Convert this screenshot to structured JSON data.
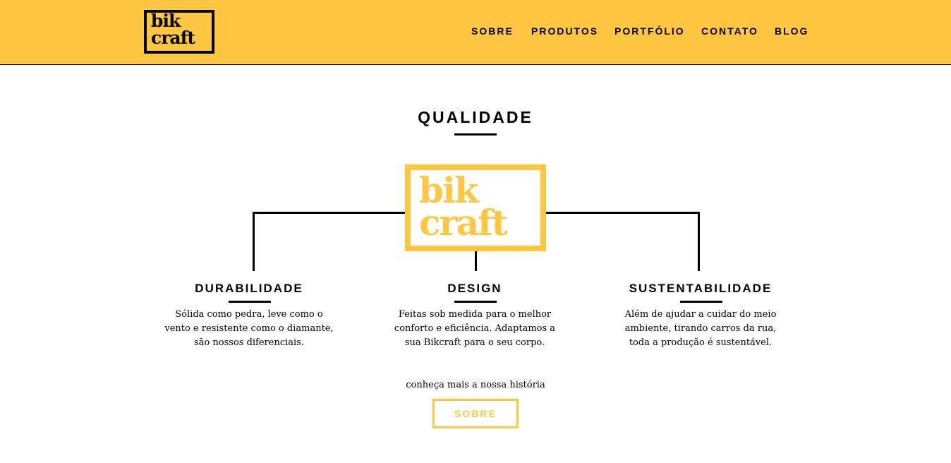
{
  "brand": {
    "logo_text": "bik\ncraft",
    "accent_color": "#fec641",
    "text_color": "#000000"
  },
  "nav": {
    "items": [
      {
        "label": "SOBRE"
      },
      {
        "label": "PRODUTOS"
      },
      {
        "label": "PORTFÓLIO"
      },
      {
        "label": "CONTATO"
      },
      {
        "label": "BLOG"
      }
    ]
  },
  "quality": {
    "title": "QUALIDADE",
    "diagram_logo_text": "bik\ncraft",
    "features": [
      {
        "title": "DURABILIDADE",
        "text": "Sólida como pedra, leve como o vento e resistente como o diamante, são nossos diferenciais."
      },
      {
        "title": "DESIGN",
        "text": "Feitas sob medida para o melhor conforto e eficiência. Adaptamos a sua Bikcraft para o seu corpo."
      },
      {
        "title": "SUSTENTABILIDADE",
        "text": "Além de ajudar a cuidar do meio ambiente, tirando carros da rua, toda a produção é sustentável."
      }
    ]
  },
  "cta": {
    "text": "conheça mais a nossa história",
    "button_label": "SOBRE"
  }
}
